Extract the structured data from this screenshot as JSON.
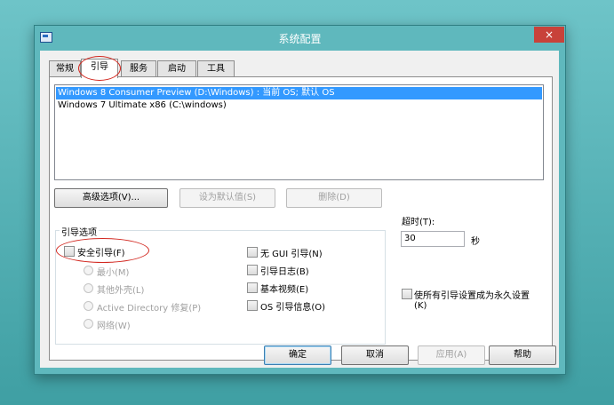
{
  "window": {
    "title": "系统配置",
    "close_glyph": "×"
  },
  "tabs": [
    {
      "label": "常规"
    },
    {
      "label": "引导"
    },
    {
      "label": "服务"
    },
    {
      "label": "启动"
    },
    {
      "label": "工具"
    }
  ],
  "boot_entries": [
    {
      "label": "Windows 8 Consumer Preview (D:\\Windows) : 当前 OS; 默认 OS",
      "selected": true
    },
    {
      "label": "Windows 7 Ultimate x86 (C:\\windows)",
      "selected": false
    }
  ],
  "entry_buttons": {
    "advanced": "高级选项(V)...",
    "set_default": "设为默认值(S)",
    "delete": "删除(D)"
  },
  "boot_options": {
    "legend": "引导选项",
    "safe_boot": "安全引导(F)",
    "radios": [
      "最小(M)",
      "其他外壳(L)",
      "Active Directory 修复(P)",
      "网络(W)"
    ],
    "checks": [
      "无 GUI 引导(N)",
      "引导日志(B)",
      "基本视频(E)",
      "OS 引导信息(O)"
    ]
  },
  "timeout": {
    "label": "超时(T):",
    "value": "30",
    "unit": "秒"
  },
  "make_permanent": {
    "line1": "使所有引导设置成为永久设置",
    "line2": "(K)"
  },
  "footer": {
    "ok": "确定",
    "cancel": "取消",
    "apply": "应用(A)",
    "help": "帮助"
  },
  "colors": {
    "selection": "#3399ff",
    "annotation": "#d2271f",
    "close_button": "#c8423a"
  }
}
